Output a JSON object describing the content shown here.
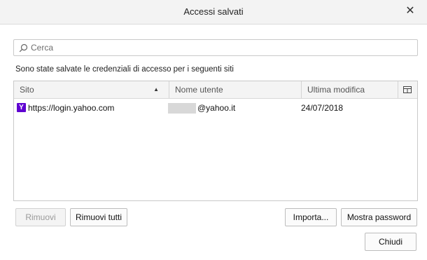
{
  "window": {
    "title": "Accessi salvati",
    "close_glyph": "✕"
  },
  "search": {
    "placeholder": "Cerca",
    "value": ""
  },
  "description": "Sono state salvate le credenziali di accesso per i seguenti siti",
  "table": {
    "columns": [
      "Sito",
      "Nome utente",
      "Ultima modifica"
    ],
    "sort_column": "Sito",
    "sort_direction": "ascending",
    "rows": [
      {
        "site": "https://login.yahoo.com",
        "favicon_letter": "Y",
        "username": "@yahoo.it",
        "modified": "24/07/2018"
      }
    ]
  },
  "buttons": {
    "remove": "Rimuovi",
    "remove_all": "Rimuovi tutti",
    "import": "Importa...",
    "show_passwords": "Mostra password",
    "close": "Chiudi"
  },
  "colors": {
    "yahoo_brand": "#5f01d1"
  }
}
